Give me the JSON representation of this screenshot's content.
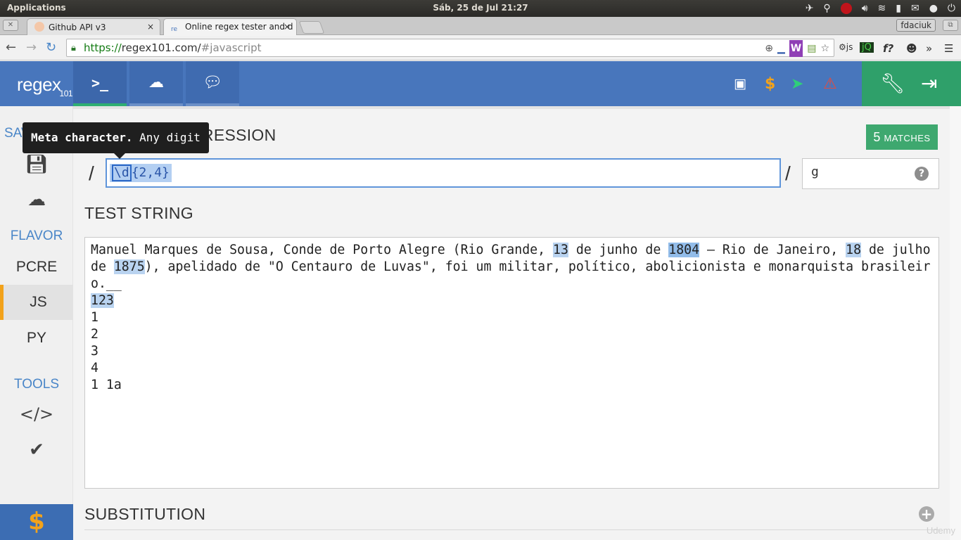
{
  "os": {
    "apps_label": "Applications",
    "clock": "Sáb, 25 de Jul 21:27"
  },
  "browser": {
    "tabs": [
      {
        "title": "Github API v3",
        "close": "×"
      },
      {
        "title": "Online regex tester and d",
        "close": "×"
      }
    ],
    "user_badge": "fdaciuk",
    "url_scheme": "https://",
    "url_host": "regex101.com/",
    "url_path": "#javascript"
  },
  "app": {
    "logo": "regex",
    "logo_sub": "101",
    "sidebar": {
      "save_head": "SAVE",
      "flavor_head": "FLAVOR",
      "flavors": [
        "PCRE",
        "JS",
        "PY"
      ],
      "tools_head": "TOOLS",
      "donate": "$"
    },
    "regex": {
      "section_title": "REGULAR EXPRESSION",
      "matches_count": "5",
      "matches_label": "MATCHES",
      "open_delim": "/",
      "close_delim": "/",
      "token": "\\d",
      "pattern_rest": "{2,4}",
      "flags": "g",
      "help": "?"
    },
    "tooltip": {
      "bold": "Meta character.",
      "text": " Any digit"
    },
    "test": {
      "section_title": "TEST STRING",
      "segments": [
        {
          "t": "Manuel Marques de Sousa, Conde de Porto Alegre (Rio Grande, ",
          "m": false
        },
        {
          "t": "13",
          "m": true
        },
        {
          "t": " de junho de ",
          "m": false
        },
        {
          "t": "1804",
          "m": true
        },
        {
          "t": " – Rio de Janeiro, ",
          "m": false
        },
        {
          "t": "18",
          "m": true
        },
        {
          "t": " de julho de ",
          "m": false
        },
        {
          "t": "1875",
          "m": true
        },
        {
          "t": "), apelidado de \"O Centauro de Luvas\", foi um militar, político, abolicionista e monarquista brasileiro.__\n",
          "m": false
        },
        {
          "t": "123",
          "m": true
        },
        {
          "t": "\n1\n2\n3\n4\n1 1a",
          "m": false
        }
      ]
    },
    "substitution": {
      "section_title": "SUBSTITUTION",
      "add": "+"
    },
    "watermark": "Udemy"
  }
}
